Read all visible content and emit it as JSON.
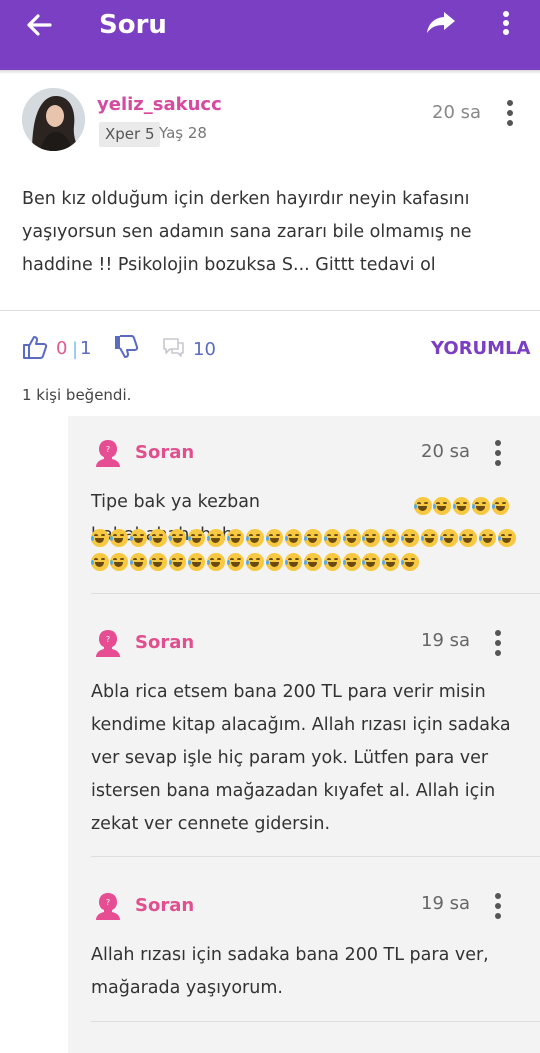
{
  "appbar": {
    "title": "Soru"
  },
  "question": {
    "username": "yeliz_sakucc",
    "xper": "Xper 5",
    "age": "Yaş 28",
    "time": "20 sa",
    "text": "Ben kız olduğum için derken hayırdır neyin kafasını yaşıyorsun sen adamın sana zararı bile olmamış ne haddine !! Psikolojin bozuksa S... Gittt tedavi ol"
  },
  "stats": {
    "likes": "0",
    "separator": "|",
    "dislikes": "1",
    "comments": "10",
    "reply_label": "YORUMLA",
    "liked_info": "1 kişi beğendi."
  },
  "comments": [
    {
      "author": "Soran",
      "time": "20 sa",
      "text": "Tipe bak ya kezban hahahahahahaha",
      "emoji_count": 5
    },
    {
      "author": "Soran",
      "time": "19 sa",
      "text": "Abla rica etsem bana 200 TL para verir misin kendime kitap alacağım. Allah rızası için sadaka ver sevap işle hiç param yok. Lütfen para ver istersen bana mağazadan kıyafet al. Allah için zekat ver cennete gidersin."
    },
    {
      "author": "Soran",
      "time": "19 sa",
      "text": "Allah rızası için sadaka bana 200 TL para ver, mağarada yaşıyorum."
    }
  ],
  "icons": [
    "back-arrow-icon",
    "share-icon",
    "more-vertical-icon",
    "thumb-up-icon",
    "thumb-down-icon",
    "comment-icon",
    "anonymous-user-icon",
    "laughing-emoji-icon"
  ],
  "colors": {
    "appbar": "#7b3fc4",
    "username": "#d64aa0",
    "soran": "#e0508f",
    "reply": "#7b3fc4"
  }
}
